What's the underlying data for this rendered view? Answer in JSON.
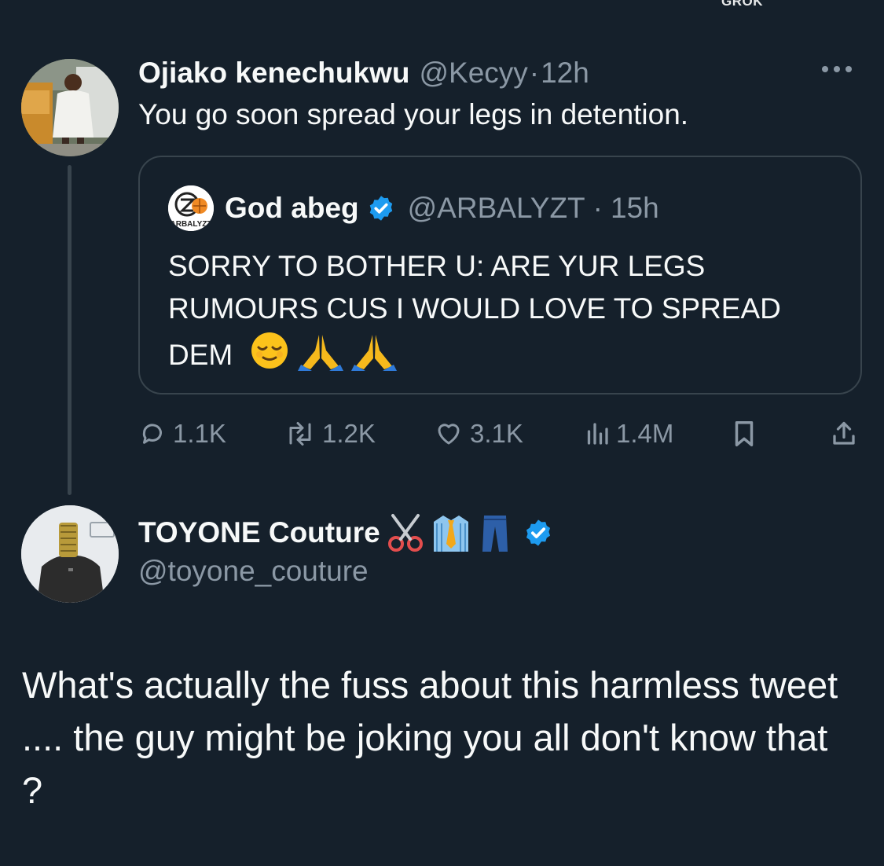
{
  "top_label": "GROK",
  "tweet": {
    "author_name": "Ojiako kenechukwu",
    "handle": "@Kecyy",
    "dot": "·",
    "time": "12h",
    "text": "You go soon spread your legs in detention.",
    "quoted": {
      "author_name": "God abeg",
      "verified": true,
      "handle": "@ARBALYZT",
      "dot": "·",
      "time": "15h",
      "avatar_text": "ARBALYZT",
      "text": "SORRY TO BOTHER U: ARE YUR LEGS RUMOURS CUS I WOULD LOVE TO SPREAD DEM",
      "emojis": [
        "relieved-face",
        "folded-hands",
        "folded-hands"
      ]
    },
    "actions": {
      "replies": "1.1K",
      "reposts": "1.2K",
      "likes": "3.1K",
      "views": "1.4M"
    }
  },
  "reply": {
    "author_name": "TOYONE Couture",
    "name_emojis": [
      "scissors",
      "shirt-tie",
      "jeans"
    ],
    "verified": true,
    "handle": "@toyone_couture",
    "text": "What's actually the fuss about this harmless tweet .... the guy might be joking you all don't know that ?"
  },
  "colors": {
    "background": "#15202b",
    "text": "#f7f9f9",
    "muted": "#8b98a5",
    "border": "#38444d",
    "verified_blue": "#1d9bf0"
  }
}
